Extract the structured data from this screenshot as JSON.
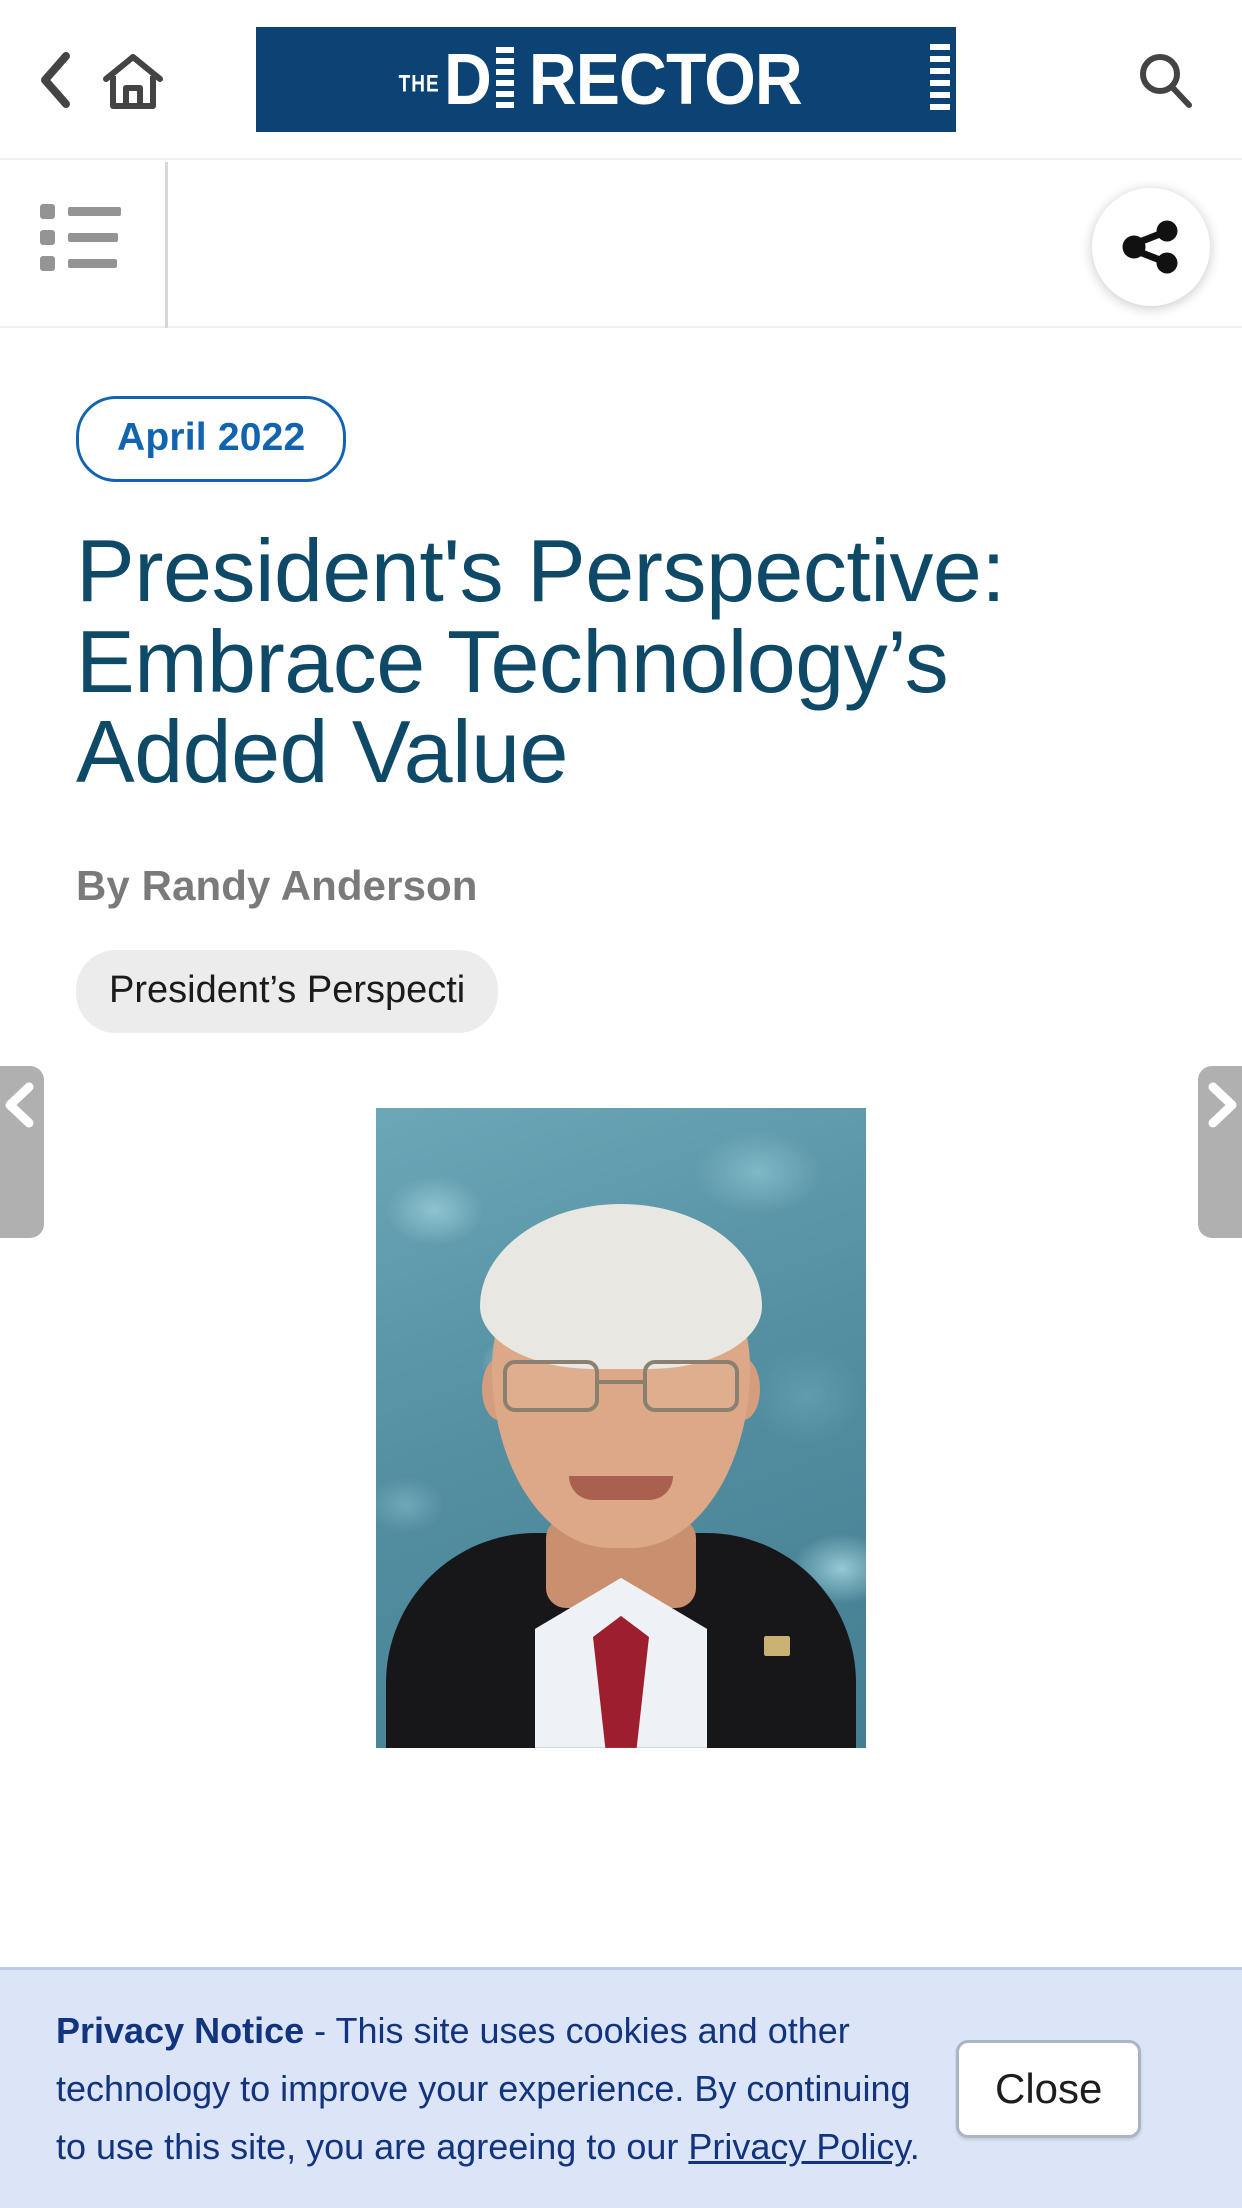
{
  "appbar": {
    "back_icon": "chevron-left-icon",
    "home_icon": "home-icon",
    "search_icon": "search-icon",
    "logo": {
      "the": "THE",
      "d": "D",
      "rest": "RECTOR",
      "full": "THE DIRECTOR"
    }
  },
  "subbar": {
    "list_icon": "list-icon",
    "share_icon": "share-icon"
  },
  "article": {
    "date_badge": "April 2022",
    "title": "President's Perspective: Embrace Technology’s Added Value",
    "byline": "By Randy Anderson",
    "tag": "President’s Perspecti",
    "portrait_alt": "Randy Anderson portrait"
  },
  "sidenav": {
    "prev_icon": "chevron-left-icon",
    "prev_label": "Previous article",
    "next_icon": "chevron-right-icon",
    "next_label": "Next article"
  },
  "privacy": {
    "heading": "Privacy Notice",
    "body_before_link": " - This site uses cookies and other technology to improve your experience. By continuing to use this site, you are agreeing to our ",
    "link_text": "Privacy Policy",
    "body_after_link": ".",
    "close_label": "Close"
  },
  "colors": {
    "brand_navy": "#0b4474",
    "title_teal": "#0e4a68",
    "badge_blue": "#1264b0",
    "privacy_bg": "#dbe5f7",
    "privacy_text": "#12337e",
    "tag_bg": "#ececec",
    "icon_gray": "#444444",
    "sidenav_gray": "#b0b0b0"
  }
}
